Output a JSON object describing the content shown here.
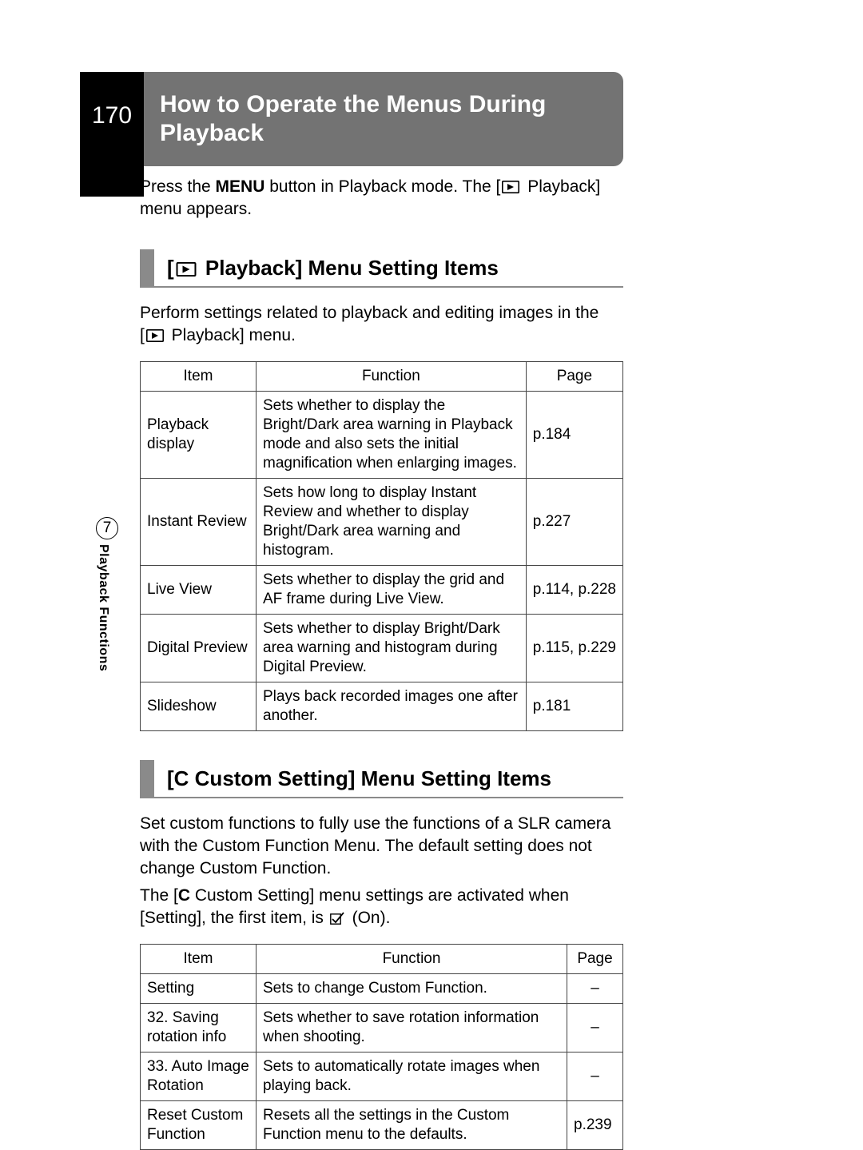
{
  "page_number": "170",
  "title_heading": "How to Operate the Menus During Playback",
  "intro_before_menu": "Press the ",
  "intro_menu_word": "MENU",
  "intro_mid": " button in Playback mode. The [",
  "intro_after_icon": " Playback] menu appears.",
  "section_playback": {
    "heading_prefix": "[",
    "heading_after_icon": " Playback] Menu Setting Items",
    "desc_1": "Perform settings related to playback and editing images in the ",
    "desc_2_prefix": "[",
    "desc_2_after_icon": " Playback] menu.",
    "headers": {
      "item": "Item",
      "function": "Function",
      "page": "Page"
    },
    "rows": [
      {
        "item": "Playback display",
        "func": "Sets whether to display the Bright/Dark area warning in Playback mode and also sets the initial magnification when enlarging images.",
        "page": "p.184"
      },
      {
        "item": "Instant Review",
        "func": "Sets how long to display Instant Review and whether to display Bright/Dark area warning and histogram.",
        "page": "p.227"
      },
      {
        "item": "Live View",
        "func": "Sets whether to display the grid and AF frame during Live View.",
        "page": "p.114, p.228"
      },
      {
        "item": "Digital Preview",
        "func": "Sets whether to display Bright/Dark area warning and histogram during Digital Preview.",
        "page": "p.115, p.229"
      },
      {
        "item": "Slideshow",
        "func": "Plays back recorded images one after another.",
        "page": "p.181"
      }
    ]
  },
  "section_custom": {
    "heading": "[C Custom Setting] Menu Setting Items",
    "desc_a": "Set custom functions to fully use the functions of a SLR camera with the Custom Function Menu. The default setting does not change Custom Function.",
    "desc_b_prefix": "The [",
    "desc_b_bold": "C",
    "desc_b_mid": " Custom Setting] menu settings are activated when [Setting], the first item, is ",
    "desc_b_after_icon": " (On).",
    "headers": {
      "item": "Item",
      "function": "Function",
      "page": "Page"
    },
    "rows": [
      {
        "item": "Setting",
        "func": "Sets to change Custom Function.",
        "page": "–"
      },
      {
        "item": "32. Saving rotation info",
        "func": "Sets whether to save rotation information when shooting.",
        "page": "–"
      },
      {
        "item": "33. Auto Image Rotation",
        "func": "Sets to automatically rotate images when playing back.",
        "page": "–"
      },
      {
        "item": "Reset Custom Function",
        "func": "Resets all the settings in the Custom Function menu to the defaults.",
        "page": "p.239"
      }
    ]
  },
  "side_tab": {
    "chapter_number": "7",
    "label": "Playback Functions"
  }
}
